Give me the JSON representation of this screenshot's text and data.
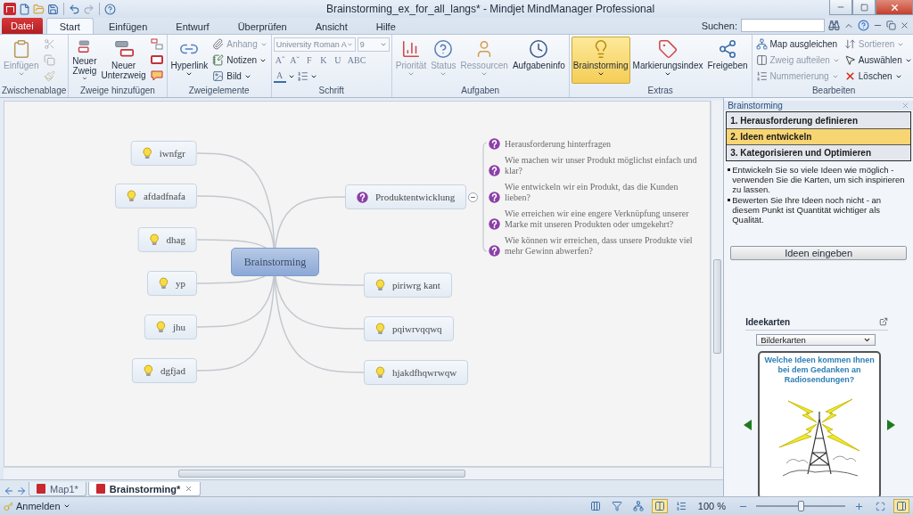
{
  "window": {
    "title": "Brainstorming_ex_for_all_langs* - Mindjet MindManager Professional"
  },
  "tabs": [
    {
      "label": "Datei",
      "kind": "file",
      "selected": false
    },
    {
      "label": "Start",
      "kind": "tab",
      "selected": true
    },
    {
      "label": "Einfügen",
      "kind": "tab",
      "selected": false
    },
    {
      "label": "Entwurf",
      "kind": "tab",
      "selected": false
    },
    {
      "label": "Überprüfen",
      "kind": "tab",
      "selected": false
    },
    {
      "label": "Ansicht",
      "kind": "tab",
      "selected": false
    },
    {
      "label": "Hilfe",
      "kind": "tab",
      "selected": false
    }
  ],
  "search": {
    "label": "Suchen:"
  },
  "ribbon": [
    {
      "label": "Zwischenablage",
      "kind": "buttons",
      "items": [
        {
          "kind": "large",
          "label": "Einfügen",
          "dropdown": true,
          "disabled": true,
          "on": false
        },
        {
          "kind": "icon",
          "disabled": true
        },
        {
          "kind": "icon",
          "disabled": true
        },
        {
          "kind": "icon",
          "disabled": true
        }
      ]
    },
    {
      "label": "Zweige hinzufügen",
      "kind": "buttons",
      "items": [
        {
          "kind": "large",
          "label": "Neuer Zweig",
          "dropdown": true,
          "disabled": false,
          "on": false
        },
        {
          "kind": "large",
          "label": "Neuer Unterzweig",
          "dropdown": false,
          "disabled": false,
          "on": false
        },
        {
          "kind": "icon",
          "disabled": false
        },
        {
          "kind": "icon",
          "disabled": false
        },
        {
          "kind": "icon",
          "disabled": false
        }
      ]
    },
    {
      "label": "Zweigelemente",
      "kind": "buttons",
      "items": [
        {
          "kind": "large",
          "label": "Hyperlink",
          "dropdown": true,
          "disabled": false,
          "on": false
        },
        {
          "kind": "small",
          "label": "Anhang",
          "dropdown": true,
          "disabled": true
        },
        {
          "kind": "small",
          "label": "Notizen",
          "dropdown": true,
          "disabled": false
        },
        {
          "kind": "small",
          "label": "Bild",
          "dropdown": true,
          "disabled": false
        }
      ]
    },
    {
      "label": "Schrift",
      "kind": "font",
      "font": "University Roman A",
      "size": "9",
      "format": [
        "Aˆ",
        "Aˇ",
        "F",
        "K",
        "U",
        "ABC"
      ],
      "color_label": "A"
    },
    {
      "label": "Aufgaben",
      "kind": "buttons",
      "items": [
        {
          "kind": "large",
          "label": "Priorität",
          "dropdown": true,
          "disabled": true,
          "on": false
        },
        {
          "kind": "large",
          "label": "Status",
          "dropdown": true,
          "disabled": true,
          "on": false
        },
        {
          "kind": "large",
          "label": "Ressourcen",
          "dropdown": true,
          "disabled": true,
          "on": false
        },
        {
          "kind": "large",
          "label": "Aufgabeninfo",
          "dropdown": false,
          "disabled": false,
          "on": false
        }
      ]
    },
    {
      "label": "Extras",
      "kind": "buttons",
      "items": [
        {
          "kind": "large",
          "label": "Brainstorming",
          "dropdown": true,
          "disabled": false,
          "on": true
        },
        {
          "kind": "large",
          "label": "Markierungsindex",
          "dropdown": true,
          "disabled": false,
          "on": false
        },
        {
          "kind": "large",
          "label": "Freigeben",
          "dropdown": false,
          "disabled": false,
          "on": false
        }
      ]
    },
    {
      "label": "Bearbeiten",
      "kind": "buttons",
      "items": [
        {
          "kind": "small",
          "label": "Map ausgleichen",
          "dropdown": false,
          "disabled": false
        },
        {
          "kind": "small",
          "label": "Zweig aufteilen",
          "dropdown": true,
          "disabled": true
        },
        {
          "kind": "small",
          "label": "Nummerierung",
          "dropdown": true,
          "disabled": true
        },
        {
          "kind": "small",
          "label": "Sortieren",
          "dropdown": true,
          "disabled": true
        },
        {
          "kind": "small",
          "label": "Auswählen",
          "dropdown": true,
          "disabled": false
        },
        {
          "kind": "small",
          "label": "Löschen",
          "dropdown": true,
          "disabled": false
        }
      ]
    }
  ],
  "map": {
    "central": "Brainstorming",
    "left": [
      {
        "label": "iwnfgr"
      },
      {
        "label": "afdadfnafa"
      },
      {
        "label": "dhag"
      },
      {
        "label": "yp"
      },
      {
        "label": "jhu"
      },
      {
        "label": "dgfjad"
      }
    ],
    "right": [
      {
        "label": "Produktentwicklung",
        "kind": "question",
        "expanded": true,
        "children": [
          {
            "label": "Herausforderung hinterfragen"
          },
          {
            "label": "Wie machen wir unser Produkt möglichst einfach und klar?"
          },
          {
            "label": "Wie entwickeln wir ein Produkt, das die Kunden lieben?"
          },
          {
            "label": "Wie erreichen wir eine engere Verknüpfung unserer Marke mit unseren Produkten oder umgekehrt?"
          },
          {
            "label": "Wie können wir erreichen, dass unsere Produkte viel mehr Gewinn abwerfen?"
          }
        ]
      },
      {
        "label": "piriwrg kant",
        "kind": "idea"
      },
      {
        "label": "pqiwrvqqwq",
        "kind": "idea"
      },
      {
        "label": "hjakdfhqwrwqw",
        "kind": "idea"
      }
    ]
  },
  "doc_tabs": [
    {
      "label": "Map1*",
      "selected": false
    },
    {
      "label": "Brainstorming*",
      "selected": true
    }
  ],
  "panel": {
    "title": "Brainstorming",
    "steps": [
      {
        "label": "1. Herausforderung definieren",
        "selected": false
      },
      {
        "label": "2. Ideen entwickeln",
        "selected": true
      },
      {
        "label": "3. Kategorisieren und Optimieren",
        "selected": false
      }
    ],
    "bullets": [
      "Entwickeln Sie so viele Ideen wie möglich - verwenden Sie die Karten, um sich inspirieren zu lassen.",
      "Bewerten Sie Ihre Ideen noch nicht - an diesem Punkt ist Quantität wichtiger als Qualität."
    ],
    "button": "Ideen eingeben",
    "cards_title": "Ideekarten",
    "card_set": "Bilderkarten",
    "card_question": "Welche Ideen kommen Ihnen bei dem Gedanken an Radiosendungen?"
  },
  "status_bar": {
    "account": "Anmelden",
    "zoom": "100 %",
    "zoom_slider": {
      "level": 0.5
    }
  }
}
